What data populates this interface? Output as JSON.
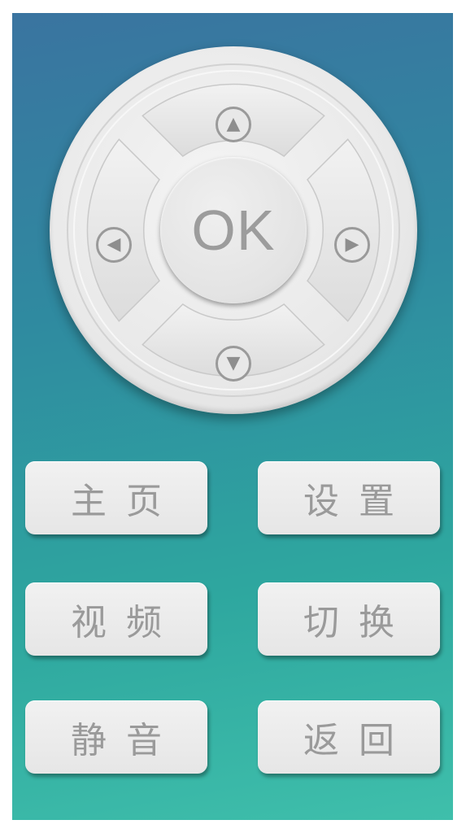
{
  "remote": {
    "ok_label": "OK",
    "arrows": {
      "up": "▲",
      "down": "▼",
      "left": "◀",
      "right": "▶"
    },
    "buttons": [
      {
        "label": "主页"
      },
      {
        "label": "设置"
      },
      {
        "label": "视频"
      },
      {
        "label": "切换"
      },
      {
        "label": "静音"
      },
      {
        "label": "返回"
      }
    ]
  },
  "colors": {
    "panel_top": "#3a74a0",
    "panel_bottom": "#3fbfab",
    "button_face": "#e8e8e8",
    "button_text": "#9a9a9a"
  }
}
